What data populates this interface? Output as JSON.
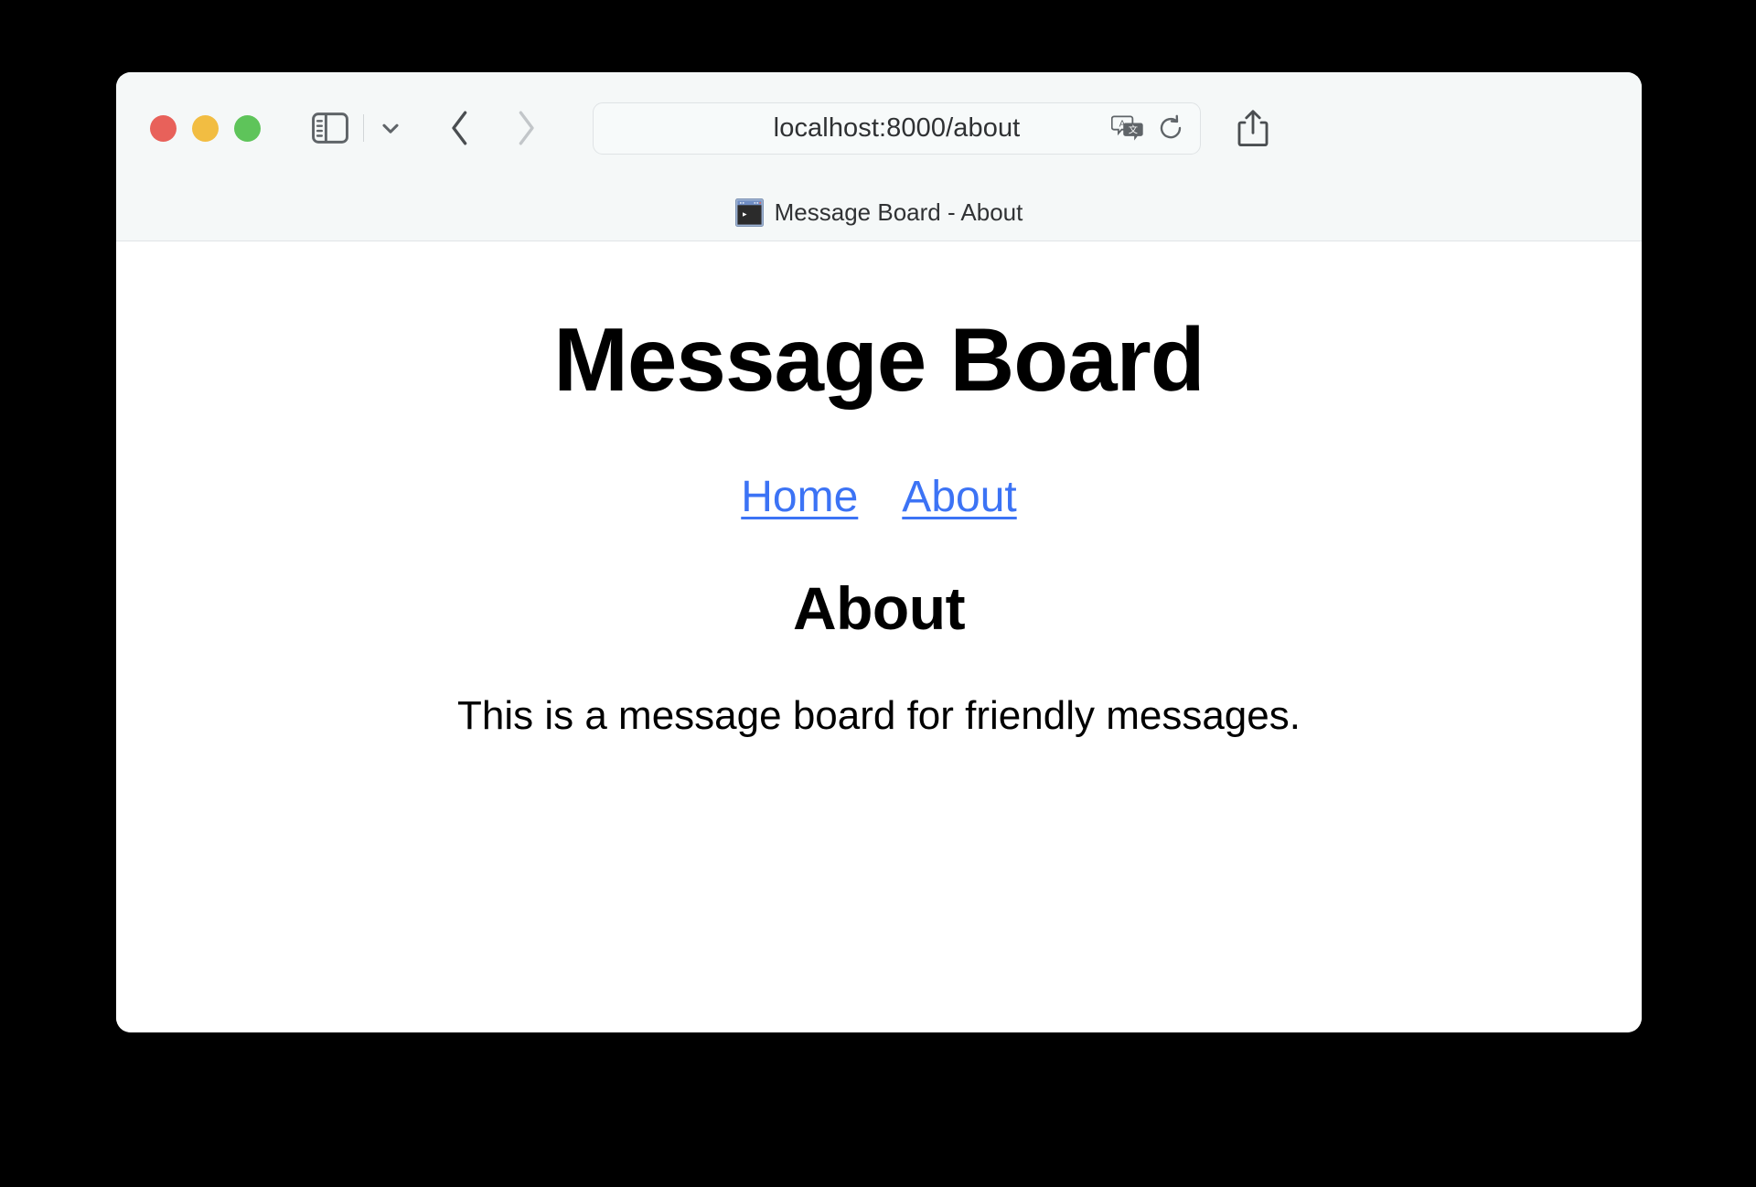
{
  "window": {
    "traffic_lights": {
      "close_label": "Close",
      "minimize_label": "Minimize",
      "zoom_label": "Zoom",
      "close_color": "#e8615a",
      "minimize_color": "#f2bd42",
      "zoom_color": "#5ec45a"
    }
  },
  "toolbar": {
    "sidebar_toggle_name": "Show Sidebar",
    "sidebar_chevron_name": "Sidebar Options",
    "back_label": "Back",
    "forward_label": "Forward",
    "share_label": "Share",
    "address": {
      "url": "localhost:8000/about",
      "placeholder": "Search or enter website name",
      "translate_label": "Translate",
      "reload_label": "Reload"
    }
  },
  "tab": {
    "favicon_name": "terminal-favicon",
    "title": "Message Board - About"
  },
  "page": {
    "site_title": "Message Board",
    "nav": [
      {
        "label": "Home"
      },
      {
        "label": "About"
      }
    ],
    "heading": "About",
    "paragraph": "This is a message board for friendly messages.",
    "link_color": "#3c73f5"
  }
}
